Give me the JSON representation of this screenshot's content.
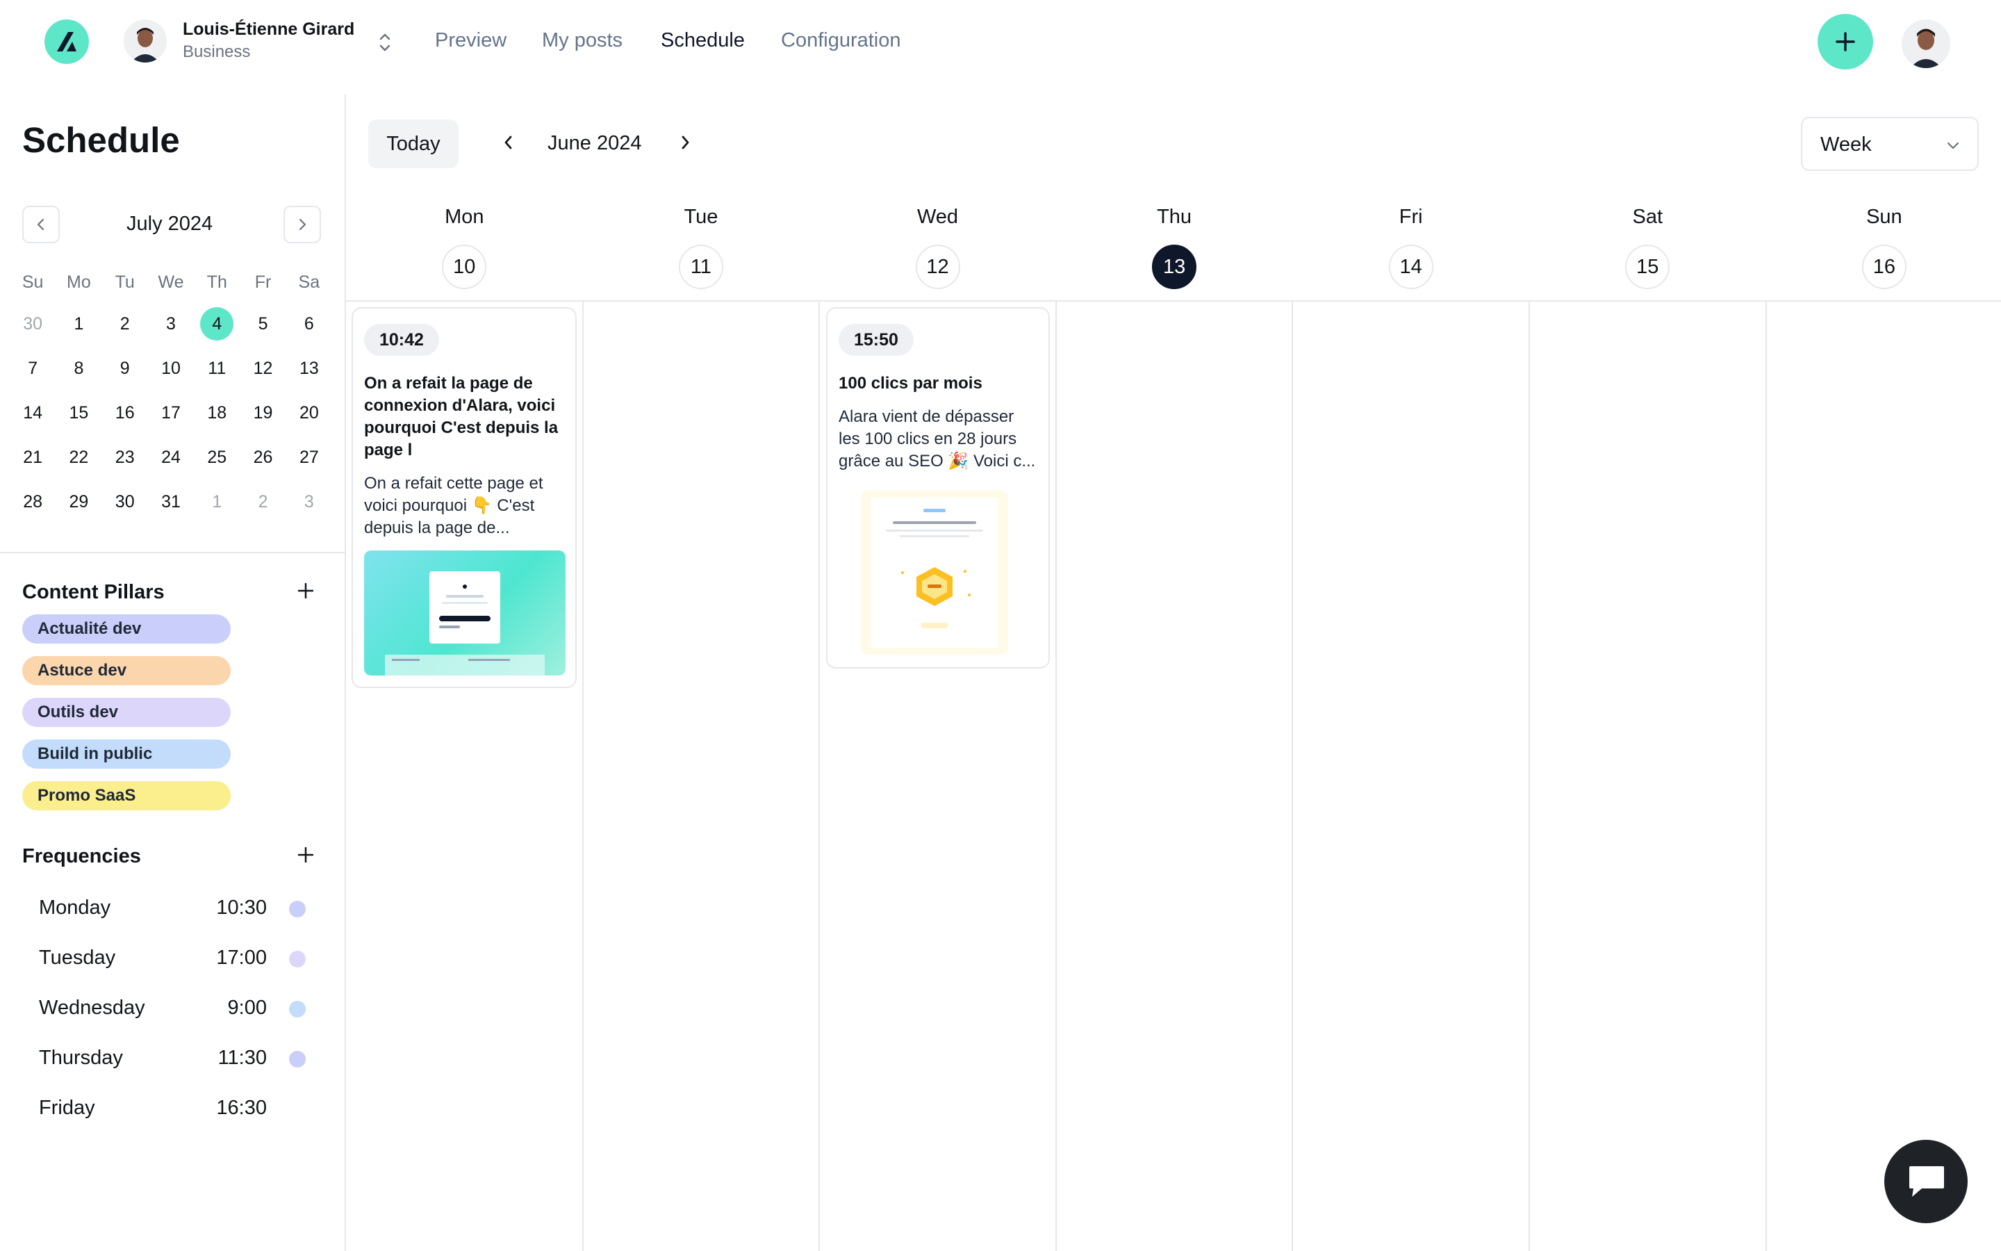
{
  "header": {
    "account_name": "Louis-Étienne Girard",
    "account_plan": "Business",
    "nav": [
      {
        "label": "Preview"
      },
      {
        "label": "My posts"
      },
      {
        "label": "Schedule"
      },
      {
        "label": "Configuration"
      }
    ],
    "active_nav": "Schedule"
  },
  "sidebar": {
    "title": "Schedule",
    "mini_calendar": {
      "month_label": "July 2024",
      "weekdays": [
        "Su",
        "Mo",
        "Tu",
        "We",
        "Th",
        "Fr",
        "Sa"
      ],
      "weeks": [
        [
          "30",
          "1",
          "2",
          "3",
          "4",
          "5",
          "6"
        ],
        [
          "7",
          "8",
          "9",
          "10",
          "11",
          "12",
          "13"
        ],
        [
          "14",
          "15",
          "16",
          "17",
          "18",
          "19",
          "20"
        ],
        [
          "21",
          "22",
          "23",
          "24",
          "25",
          "26",
          "27"
        ],
        [
          "28",
          "29",
          "30",
          "31",
          "1",
          "2",
          "3"
        ]
      ],
      "selected_day": "4"
    },
    "content_pillars": {
      "title": "Content Pillars",
      "items": [
        {
          "label": "Actualité dev",
          "color": "#c9cefa"
        },
        {
          "label": "Astuce dev",
          "color": "#fbd5ab"
        },
        {
          "label": "Outils dev",
          "color": "#ddd6fb"
        },
        {
          "label": "Build in public",
          "color": "#c3dcfb"
        },
        {
          "label": "Promo SaaS",
          "color": "#fbee8c"
        }
      ]
    },
    "frequencies": {
      "title": "Frequencies",
      "items": [
        {
          "day": "Monday",
          "time": "10:30",
          "color": "#c9cefa"
        },
        {
          "day": "Tuesday",
          "time": "17:00",
          "color": "#ddd6fb"
        },
        {
          "day": "Wednesday",
          "time": "9:00",
          "color": "#c3dcfb"
        },
        {
          "day": "Thursday",
          "time": "11:30",
          "color": "#c9cefa"
        },
        {
          "day": "Friday",
          "time": "16:30",
          "color": ""
        }
      ]
    }
  },
  "calendar": {
    "today_label": "Today",
    "range_label": "June 2024",
    "view": "Week",
    "days": [
      {
        "name": "Mon",
        "num": "10"
      },
      {
        "name": "Tue",
        "num": "11"
      },
      {
        "name": "Wed",
        "num": "12"
      },
      {
        "name": "Thu",
        "num": "13",
        "today": true
      },
      {
        "name": "Fri",
        "num": "14"
      },
      {
        "name": "Sat",
        "num": "15"
      },
      {
        "name": "Sun",
        "num": "16"
      }
    ],
    "posts": [
      {
        "day": "Mon",
        "time": "10:42",
        "title": "On a refait la page de connexion d'Alara, voici pourquoi C'est depuis la page l",
        "excerpt": "On a refait cette page et voici pourquoi 👇 C'est depuis la page de..."
      },
      {
        "day": "Wed",
        "time": "15:50",
        "title": "100 clics par mois",
        "excerpt": "Alara vient de dépasser les 100 clics en 28 jours grâce au SEO 🎉 Voici c..."
      }
    ]
  },
  "colors": {
    "accent": "#5ee6c8",
    "today_badge": "#0f172a"
  },
  "icons": [
    "logo-icon",
    "chevrons-up-down-icon",
    "plus-icon",
    "chevron-left-icon",
    "chevron-right-icon",
    "chevron-down-icon",
    "chat-icon"
  ]
}
